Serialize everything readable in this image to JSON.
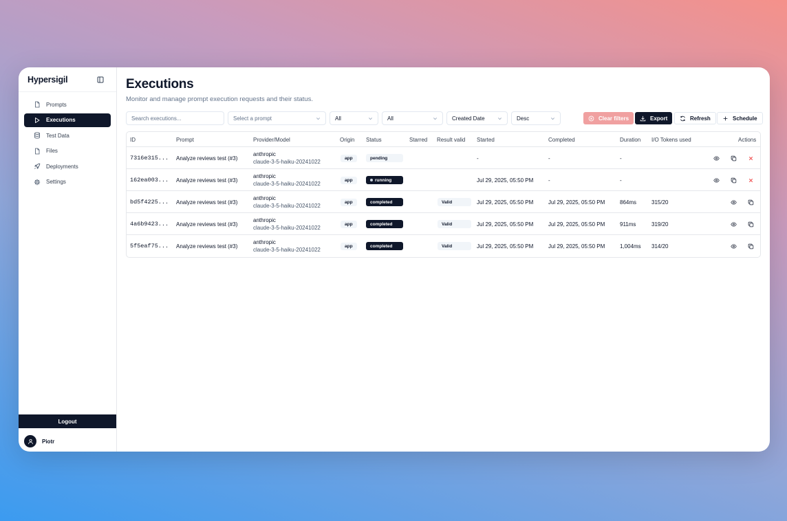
{
  "app": {
    "title": "Hypersigil"
  },
  "sidebar": {
    "items": [
      {
        "label": "Prompts",
        "icon": "file-icon"
      },
      {
        "label": "Executions",
        "icon": "play-icon"
      },
      {
        "label": "Test Data",
        "icon": "database-icon"
      },
      {
        "label": "Files",
        "icon": "file-icon"
      },
      {
        "label": "Deployments",
        "icon": "rocket-icon"
      },
      {
        "label": "Settings",
        "icon": "gear-icon"
      }
    ],
    "active_index": 1,
    "logout_label": "Logout",
    "user_name": "Piotr"
  },
  "page": {
    "title": "Executions",
    "subtitle": "Monitor and manage prompt execution requests and their status."
  },
  "filters": {
    "search_placeholder": "Search executions...",
    "prompt_placeholder": "Select a prompt",
    "origin_value": "All",
    "status_value": "All",
    "sort_field": "Created Date",
    "sort_order": "Desc",
    "clear_label": "Clear filters",
    "export_label": "Export",
    "refresh_label": "Refresh",
    "schedule_label": "Schedule"
  },
  "table": {
    "headers": {
      "id": "ID",
      "prompt": "Prompt",
      "provider": "Provider/Model",
      "origin": "Origin",
      "status": "Status",
      "starred": "Starred",
      "result_valid": "Result valid",
      "started": "Started",
      "completed": "Completed",
      "duration": "Duration",
      "tokens": "I/O Tokens used",
      "actions": "Actions"
    },
    "rows": [
      {
        "id": "7316e315...",
        "prompt": "Analyze reviews test (#3)",
        "provider": "anthropic",
        "model": "claude-3-5-haiku-20241022",
        "origin": "app",
        "status": "pending",
        "result_valid": "",
        "started": "-",
        "completed": "-",
        "duration": "-",
        "tokens": ""
      },
      {
        "id": "162ea003...",
        "prompt": "Analyze reviews test (#3)",
        "provider": "anthropic",
        "model": "claude-3-5-haiku-20241022",
        "origin": "app",
        "status": "running",
        "result_valid": "",
        "started": "Jul 29, 2025, 05:50 PM",
        "completed": "-",
        "duration": "-",
        "tokens": ""
      },
      {
        "id": "bd5f4225...",
        "prompt": "Analyze reviews test (#3)",
        "provider": "anthropic",
        "model": "claude-3-5-haiku-20241022",
        "origin": "app",
        "status": "completed",
        "result_valid": "Valid",
        "started": "Jul 29, 2025, 05:50 PM",
        "completed": "Jul 29, 2025, 05:50 PM",
        "duration": "864ms",
        "tokens": "315/20"
      },
      {
        "id": "4a6b9423...",
        "prompt": "Analyze reviews test (#3)",
        "provider": "anthropic",
        "model": "claude-3-5-haiku-20241022",
        "origin": "app",
        "status": "completed",
        "result_valid": "Valid",
        "started": "Jul 29, 2025, 05:50 PM",
        "completed": "Jul 29, 2025, 05:50 PM",
        "duration": "911ms",
        "tokens": "319/20"
      },
      {
        "id": "5f5eaf75...",
        "prompt": "Analyze reviews test (#3)",
        "provider": "anthropic",
        "model": "claude-3-5-haiku-20241022",
        "origin": "app",
        "status": "completed",
        "result_valid": "Valid",
        "started": "Jul 29, 2025, 05:50 PM",
        "completed": "Jul 29, 2025, 05:50 PM",
        "duration": "1,004ms",
        "tokens": "314/20"
      }
    ]
  },
  "colors": {
    "accent": "#0f172a",
    "danger": "#ef4444",
    "clear_button": "#f0a0a0"
  }
}
